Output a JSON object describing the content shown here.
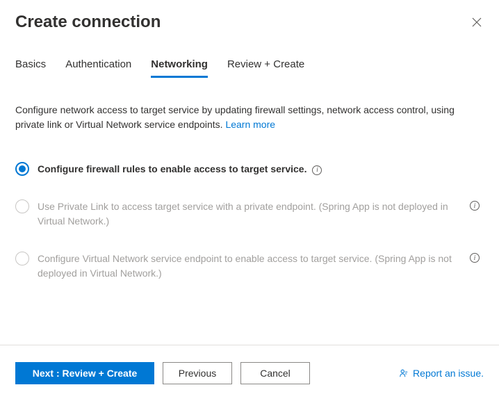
{
  "header": {
    "title": "Create connection"
  },
  "tabs": {
    "items": [
      {
        "label": "Basics"
      },
      {
        "label": "Authentication"
      },
      {
        "label": "Networking"
      },
      {
        "label": "Review + Create"
      }
    ],
    "active_index": 2
  },
  "description": {
    "text": "Configure network access to target service by updating firewall settings, network access control, using private link or Virtual Network service endpoints. ",
    "learn_more": "Learn more"
  },
  "options": [
    {
      "label": "Configure firewall rules to enable access to target service.",
      "selected": true,
      "disabled": false
    },
    {
      "label": "Use Private Link to access target service with a private endpoint. (Spring App is not deployed in Virtual Network.)",
      "selected": false,
      "disabled": true
    },
    {
      "label": "Configure Virtual Network service endpoint to enable access to target service. (Spring App is not deployed in Virtual Network.)",
      "selected": false,
      "disabled": true
    }
  ],
  "footer": {
    "primary": "Next : Review + Create",
    "previous": "Previous",
    "cancel": "Cancel",
    "report": "Report an issue."
  }
}
